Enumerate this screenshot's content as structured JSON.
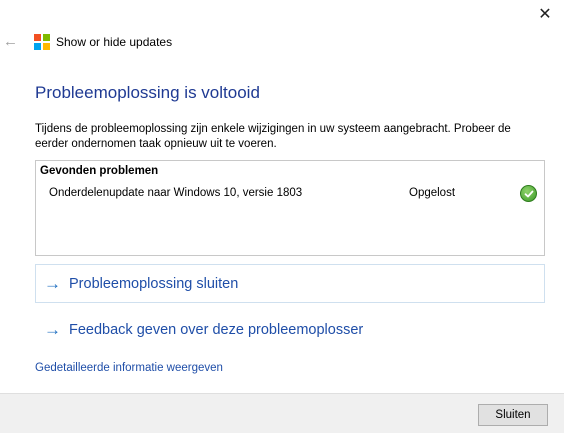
{
  "window": {
    "close_glyph": "✕",
    "back_glyph": "←",
    "title": "Show or hide updates"
  },
  "main": {
    "heading": "Probleemoplossing is voltooid",
    "description": "Tijdens de probleemoplossing zijn enkele wijzigingen in uw systeem aangebracht. Probeer de eerder ondernomen taak opnieuw uit te voeren."
  },
  "problems": {
    "header": "Gevonden problemen",
    "rows": [
      {
        "name": "Onderdelenupdate naar Windows 10, versie 1803",
        "status": "Opgelost",
        "icon": "checkmark-icon"
      }
    ]
  },
  "commands": {
    "arrow_glyph": "→",
    "close_troubleshooting": "Probleemoplossing sluiten",
    "feedback": "Feedback geven over deze probleemoplosser"
  },
  "details_link": "Gedetailleerde informatie weergeven",
  "footer": {
    "close_button": "Sluiten"
  },
  "colors": {
    "heading": "#1f3a93",
    "link": "#1f4ea8",
    "success": "#3c9a28"
  }
}
